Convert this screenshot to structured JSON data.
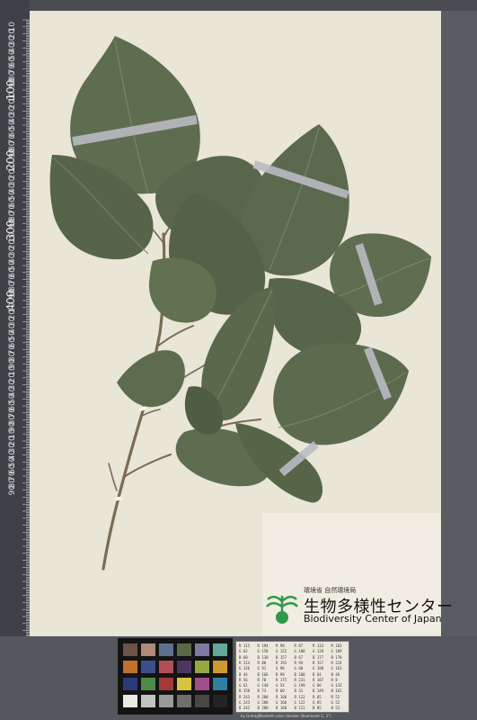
{
  "image": {
    "subject": "Herbarium specimen sheet of a leafy branch with broad heart-shaped leaves",
    "background_color": "#4a4c52",
    "sheet_color": "#e9e5d7",
    "leaf_color": "#5c6b4e",
    "stem_color": "#7a6b55"
  },
  "ruler": {
    "unit_label": "mm",
    "major_labels": [
      "100",
      "200",
      "300",
      "400"
    ],
    "minor_labels": [
      "10",
      "20",
      "30",
      "40",
      "50",
      "60",
      "70",
      "80",
      "90",
      "10",
      "20",
      "30",
      "40",
      "50",
      "60",
      "70",
      "80",
      "90",
      "10",
      "20",
      "30",
      "40",
      "50",
      "60",
      "70",
      "80",
      "90",
      "10",
      "20",
      "30",
      "40",
      "50",
      "60",
      "70",
      "80",
      "90",
      "10",
      "20",
      "30",
      "40",
      "50",
      "60",
      "70",
      "80",
      "90",
      "10",
      "20",
      "30",
      "40",
      "50",
      "60",
      "70",
      "80",
      "90",
      "10",
      "20",
      "30",
      "40",
      "50",
      "60",
      "70",
      "80",
      "90"
    ]
  },
  "label_card": {
    "agency": "環境省 自然環境局",
    "center_jp": "生物多様性センター",
    "center_en": "Biodiversity Center of Japan"
  },
  "color_checker": {
    "swatches": [
      "#6b5346",
      "#b08a78",
      "#5f6f8e",
      "#596b44",
      "#7c7aa2",
      "#63a89a",
      "#c0722e",
      "#3e4d8c",
      "#b24e58",
      "#4d3660",
      "#96a73f",
      "#cf9a30",
      "#2a3a7a",
      "#4e8a48",
      "#a33a37",
      "#d9c440",
      "#a44d8c",
      "#2f7fa0",
      "#e9e9e6",
      "#c3c3c0",
      "#9a9a98",
      "#6f6f6d",
      "#474746",
      "#242424"
    ]
  },
  "reference_table": {
    "rows": [
      [
        "R 115",
        "R 194",
        "R 98",
        "R 87",
        "R 133",
        "R 103"
      ],
      [
        "G 82",
        "G 150",
        "G 122",
        "G 108",
        "G 128",
        "G 189"
      ],
      [
        "B 68",
        "B 130",
        "B 157",
        "B 67",
        "B 177",
        "B 170"
      ],
      [
        "R 214",
        "R 80",
        "R 193",
        "R 94",
        "R 157",
        "R 224"
      ],
      [
        "G 126",
        "G 91",
        "G 90",
        "G 60",
        "G 188",
        "G 163"
      ],
      [
        "B 44",
        "B 166",
        "B 99",
        "B 108",
        "B 64",
        "B 46"
      ],
      [
        "R 56",
        "R 70",
        "R 175",
        "R 231",
        "R 187",
        "R 8"
      ],
      [
        "G 61",
        "G 148",
        "G 54",
        "G 199",
        "G 86",
        "G 133"
      ],
      [
        "B 150",
        "B 73",
        "B 60",
        "B 31",
        "B 149",
        "B 161"
      ],
      [
        "R 243",
        "R 200",
        "R 160",
        "R 122",
        "R 85",
        "R 52"
      ],
      [
        "G 243",
        "G 200",
        "G 160",
        "G 122",
        "G 85",
        "G 52"
      ],
      [
        "B 242",
        "B 200",
        "B 160",
        "B 121",
        "B 85",
        "B 52"
      ]
    ],
    "note": "by GretagMacbeth color checker (Illuminant C, 2°)"
  }
}
